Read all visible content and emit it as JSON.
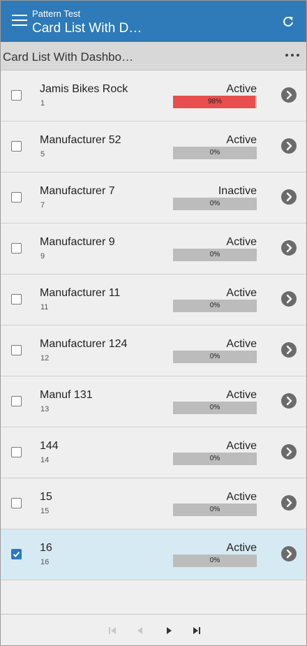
{
  "header": {
    "subtitle": "Pattern Test",
    "title": "Card List With D…"
  },
  "toolbar": {
    "title": "Card List With Dashboar…"
  },
  "rows": [
    {
      "name": "Jamis Bikes Rock",
      "id": "1",
      "status": "Active",
      "progress_label": "98%",
      "progress": 98,
      "checked": false
    },
    {
      "name": "Manufacturer 52",
      "id": "5",
      "status": "Active",
      "progress_label": "0%",
      "progress": 0,
      "checked": false
    },
    {
      "name": "Manufacturer 7",
      "id": "7",
      "status": "Inactive",
      "progress_label": "0%",
      "progress": 0,
      "checked": false
    },
    {
      "name": "Manufacturer 9",
      "id": "9",
      "status": "Active",
      "progress_label": "0%",
      "progress": 0,
      "checked": false
    },
    {
      "name": "Manufacturer 11",
      "id": "11",
      "status": "Active",
      "progress_label": "0%",
      "progress": 0,
      "checked": false
    },
    {
      "name": "Manufacturer 124",
      "id": "12",
      "status": "Active",
      "progress_label": "0%",
      "progress": 0,
      "checked": false
    },
    {
      "name": "Manuf 131",
      "id": "13",
      "status": "Active",
      "progress_label": "0%",
      "progress": 0,
      "checked": false
    },
    {
      "name": "144",
      "id": "14",
      "status": "Active",
      "progress_label": "0%",
      "progress": 0,
      "checked": false
    },
    {
      "name": "15",
      "id": "15",
      "status": "Active",
      "progress_label": "0%",
      "progress": 0,
      "checked": false
    },
    {
      "name": "16",
      "id": "16",
      "status": "Active",
      "progress_label": "0%",
      "progress": 0,
      "checked": true
    }
  ],
  "colors": {
    "header_bg": "#2f7ab8",
    "progress_fill": "#e84e4e",
    "selected_row": "#d6eaf3",
    "checkbox_checked": "#2b78c8"
  },
  "icons": {
    "menu": "hamburger-icon",
    "refresh": "refresh-icon",
    "more": "more-horizontal-icon",
    "row_nav": "chevron-right-circle-icon",
    "pager": [
      "first-page-icon",
      "previous-page-icon",
      "next-page-icon",
      "last-page-icon"
    ]
  }
}
